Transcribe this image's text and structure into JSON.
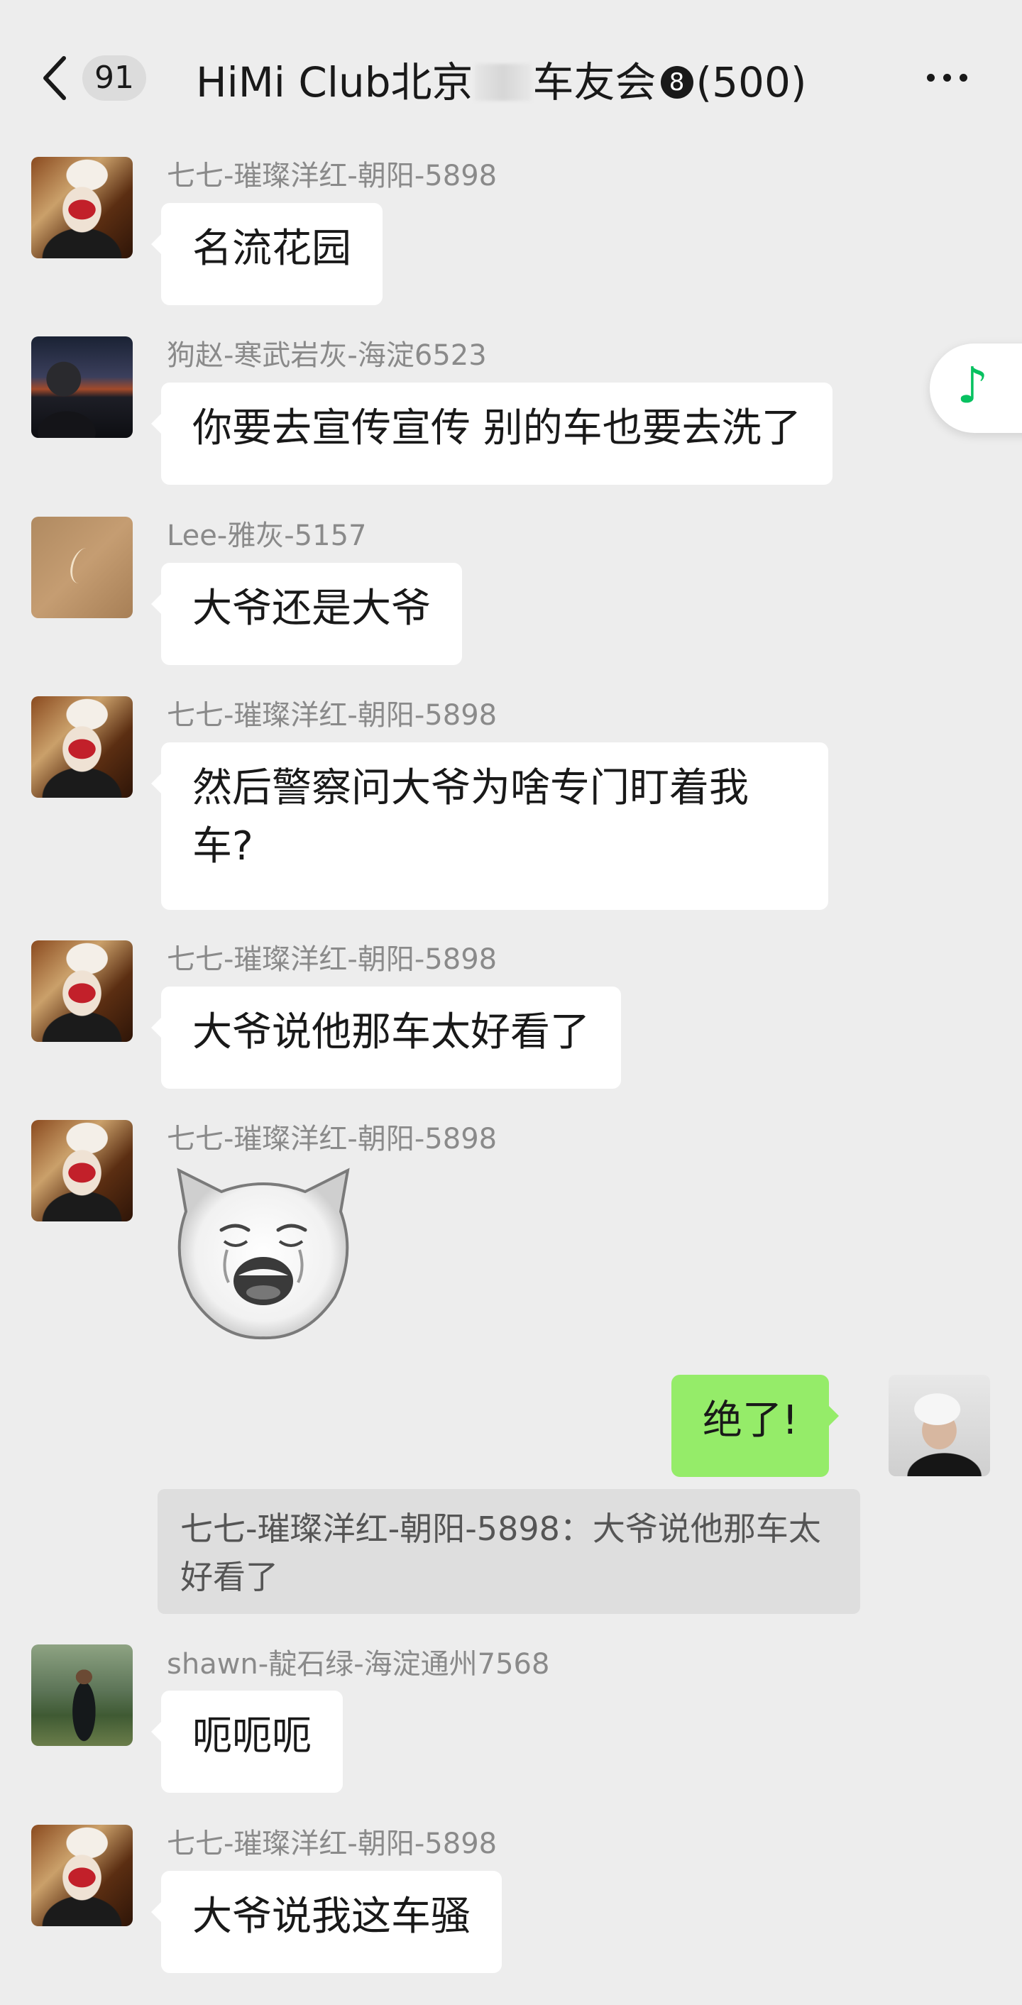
{
  "header": {
    "unread_count": "91",
    "title_part1": "HiMi Club北京",
    "title_part2": "车友会",
    "mute_badge": "8",
    "member_count": "(500)"
  },
  "messages": [
    {
      "sender": "七七-璀璨洋红-朝阳-5898",
      "text": "名流花园"
    },
    {
      "sender": "狗赵-寒武岩灰-海淀6523",
      "text": "你要去宣传宣传 别的车也要去洗了"
    },
    {
      "sender": "Lee-雅灰-5157",
      "text": "大爷还是大爷"
    },
    {
      "sender": "七七-璀璨洋红-朝阳-5898",
      "text": "然后警察问大爷为啥专门盯着我车?"
    },
    {
      "sender": "七七-璀璨洋红-朝阳-5898",
      "text": "大爷说他那车太好看了"
    },
    {
      "sender": "七七-璀璨洋红-朝阳-5898",
      "text": ""
    },
    {
      "sender": "",
      "text": "绝了!"
    },
    {
      "sender": "shawn-靛石绿-海淀通州7568",
      "text": "呃呃呃"
    },
    {
      "sender": "七七-璀璨洋红-朝阳-5898",
      "text": "大爷说我这车骚"
    }
  ],
  "quote": {
    "text": "七七-璀璨洋红-朝阳-5898：大爷说他那车太好看了"
  },
  "colors": {
    "background": "#ededed",
    "bubble_incoming": "#ffffff",
    "bubble_outgoing": "#95ec69",
    "sender_name": "#8a8a8a",
    "music_icon": "#07c160"
  },
  "icons": {
    "back": "chevron-left-icon",
    "more": "more-dots-icon",
    "music": "music-note-icon",
    "sticker": "crying-cat-sticker"
  }
}
